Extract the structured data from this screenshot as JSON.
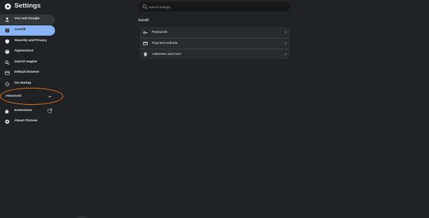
{
  "header": {
    "title": "Settings",
    "search": {
      "placeholder": "Search settings"
    }
  },
  "sidebar": {
    "items": [
      {
        "label": "You and Google",
        "icon": "person-icon"
      },
      {
        "label": "Autofill",
        "icon": "autofill-icon",
        "active": true
      },
      {
        "label": "Security and Privacy",
        "icon": "shield-icon"
      },
      {
        "label": "Appearance",
        "icon": "palette-icon"
      },
      {
        "label": "Search engine",
        "icon": "search-icon"
      },
      {
        "label": "Default browser",
        "icon": "browser-icon"
      },
      {
        "label": "On startup",
        "icon": "power-icon"
      }
    ],
    "advanced_label": "Advanced",
    "extensions_label": "Extensions",
    "about_label": "About Chrome"
  },
  "main": {
    "section_title": "Autofill",
    "rows": [
      {
        "label": "Passwords",
        "icon": "key-icon"
      },
      {
        "label": "Payment methods",
        "icon": "credit-card-icon"
      },
      {
        "label": "Addresses and more",
        "icon": "location-pin-icon"
      }
    ]
  },
  "colors": {
    "background": "#202124",
    "accent": "#8ab4f8",
    "card": "#292a2d",
    "highlight_annotation": "#e8771c"
  }
}
